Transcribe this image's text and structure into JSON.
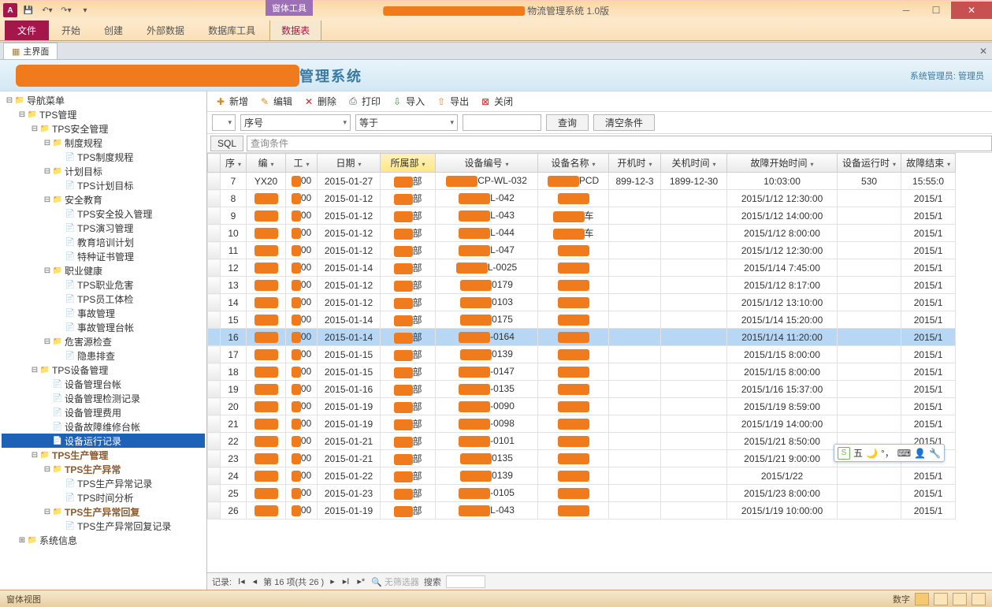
{
  "window": {
    "title_suffix": "物流管理系统 1.0版",
    "contextual": "窗体工具"
  },
  "ribbon": {
    "file": "文件",
    "tabs": [
      "开始",
      "创建",
      "外部数据",
      "数据库工具",
      "数据表"
    ]
  },
  "doc_tab": {
    "label": "主界面"
  },
  "banner": {
    "title_suffix": "管理系统",
    "right": "系统管理员: 管理员"
  },
  "tree": [
    {
      "d": 0,
      "t": "fold",
      "exp": "-",
      "label": "导航菜单"
    },
    {
      "d": 1,
      "t": "fold",
      "exp": "-",
      "label": "TPS管理"
    },
    {
      "d": 2,
      "t": "fold",
      "exp": "-",
      "label": "TPS安全管理"
    },
    {
      "d": 3,
      "t": "fold",
      "exp": "-",
      "label": "制度规程"
    },
    {
      "d": 4,
      "t": "page",
      "label": "TPS制度规程"
    },
    {
      "d": 3,
      "t": "fold",
      "exp": "-",
      "label": "计划目标"
    },
    {
      "d": 4,
      "t": "page",
      "label": "TPS计划目标"
    },
    {
      "d": 3,
      "t": "fold",
      "exp": "-",
      "label": "安全教育"
    },
    {
      "d": 4,
      "t": "page",
      "label": "TPS安全投入管理"
    },
    {
      "d": 4,
      "t": "page",
      "label": "TPS演习管理"
    },
    {
      "d": 4,
      "t": "page",
      "label": "教育培训计划"
    },
    {
      "d": 4,
      "t": "page",
      "label": "特种证书管理"
    },
    {
      "d": 3,
      "t": "fold",
      "exp": "-",
      "label": "职业健康"
    },
    {
      "d": 4,
      "t": "page",
      "label": "TPS职业危害"
    },
    {
      "d": 4,
      "t": "page",
      "label": "TPS员工体检"
    },
    {
      "d": 4,
      "t": "page",
      "label": "事故管理"
    },
    {
      "d": 4,
      "t": "page",
      "label": "事故管理台帐"
    },
    {
      "d": 3,
      "t": "fold",
      "exp": "-",
      "label": "危害源检查"
    },
    {
      "d": 4,
      "t": "page",
      "label": "隐患排查"
    },
    {
      "d": 2,
      "t": "fold",
      "exp": "-",
      "label": "TPS设备管理"
    },
    {
      "d": 3,
      "t": "page",
      "label": "设备管理台帐"
    },
    {
      "d": 3,
      "t": "page",
      "label": "设备管理检测记录"
    },
    {
      "d": 3,
      "t": "page",
      "label": "设备管理费用"
    },
    {
      "d": 3,
      "t": "page",
      "label": "设备故障维修台帐"
    },
    {
      "d": 3,
      "t": "page",
      "label": "设备运行记录",
      "sel": true
    },
    {
      "d": 2,
      "t": "fold",
      "exp": "-",
      "label": "TPS生产管理",
      "brown": true
    },
    {
      "d": 3,
      "t": "fold",
      "exp": "-",
      "label": "TPS生产异常",
      "brown": true
    },
    {
      "d": 4,
      "t": "page",
      "label": "TPS生产异常记录"
    },
    {
      "d": 4,
      "t": "page",
      "label": "TPS时间分析"
    },
    {
      "d": 3,
      "t": "fold",
      "exp": "-",
      "label": "TPS生产异常回复",
      "brown": true
    },
    {
      "d": 4,
      "t": "page",
      "label": "TPS生产异常回复记录"
    },
    {
      "d": 1,
      "t": "fold",
      "exp": "+",
      "label": "系统信息"
    }
  ],
  "toolbar": {
    "new": "新增",
    "edit": "编辑",
    "del": "删除",
    "print": "打印",
    "import": "导入",
    "export": "导出",
    "close": "关闭"
  },
  "filter": {
    "field": "序号",
    "op": "等于",
    "query": "查询",
    "clear": "清空条件",
    "sql": "SQL",
    "sql_ph": "查询条件"
  },
  "grid": {
    "cols": [
      "",
      "序",
      "编",
      "工",
      "日期",
      "所属部",
      "设备编号",
      "设备名称",
      "开机时",
      "关机时间",
      "故障开始时间",
      "设备运行时",
      "故障结束"
    ],
    "rows": [
      {
        "n": 7,
        "a": "YX20",
        "b": "00",
        "d": "2015-01-27",
        "dev": "CP-WL-032",
        "name": "PCD",
        "on": "899-12-3",
        "off": "1899-12-30",
        "fs": "10:03:00",
        "rt": "530",
        "fe": "15:55:0"
      },
      {
        "n": 8,
        "b": "00",
        "d": "2015-01-12",
        "dev": "L-042",
        "fs": "2015/1/12 12:30:00",
        "fe": "2015/1"
      },
      {
        "n": 9,
        "b": "00",
        "d": "2015-01-12",
        "dev": "L-043",
        "name": "车",
        "fs": "2015/1/12 14:00:00",
        "fe": "2015/1"
      },
      {
        "n": 10,
        "b": "00",
        "d": "2015-01-12",
        "dev": "L-044",
        "name": "车",
        "fs": "2015/1/12 8:00:00",
        "fe": "2015/1"
      },
      {
        "n": 11,
        "b": "00",
        "d": "2015-01-12",
        "dev": "L-047",
        "fs": "2015/1/12 12:30:00",
        "fe": "2015/1"
      },
      {
        "n": 12,
        "b": "00",
        "d": "2015-01-14",
        "dev": "L-0025",
        "fs": "2015/1/14 7:45:00",
        "fe": "2015/1"
      },
      {
        "n": 13,
        "b": "00",
        "d": "2015-01-12",
        "dev": "0179",
        "fs": "2015/1/12 8:17:00",
        "fe": "2015/1"
      },
      {
        "n": 14,
        "b": "00",
        "d": "2015-01-12",
        "dev": "0103",
        "fs": "2015/1/12 13:10:00",
        "fe": "2015/1"
      },
      {
        "n": 15,
        "b": "00",
        "d": "2015-01-14",
        "dev": "0175",
        "fs": "2015/1/14 15:20:00",
        "fe": "2015/1"
      },
      {
        "n": 16,
        "b": "00",
        "d": "2015-01-14",
        "dev": "-0164",
        "fs": "2015/1/14 11:20:00",
        "fe": "2015/1",
        "sel": true
      },
      {
        "n": 17,
        "b": "00",
        "d": "2015-01-15",
        "dev": "0139",
        "fs": "2015/1/15 8:00:00",
        "fe": "2015/1"
      },
      {
        "n": 18,
        "b": "00",
        "d": "2015-01-15",
        "dev": "-0147",
        "fs": "2015/1/15 8:00:00",
        "fe": "2015/1"
      },
      {
        "n": 19,
        "b": "00",
        "d": "2015-01-16",
        "dev": "-0135",
        "fs": "2015/1/16 15:37:00",
        "fe": "2015/1"
      },
      {
        "n": 20,
        "b": "00",
        "d": "2015-01-19",
        "dev": "-0090",
        "fs": "2015/1/19 8:59:00",
        "fe": "2015/1"
      },
      {
        "n": 21,
        "b": "00",
        "d": "2015-01-19",
        "dev": "-0098",
        "fs": "2015/1/19 14:00:00",
        "fe": "2015/1"
      },
      {
        "n": 22,
        "b": "00",
        "d": "2015-01-21",
        "dev": "-0101",
        "fs": "2015/1/21 8:50:00",
        "fe": "2015/1"
      },
      {
        "n": 23,
        "b": "00",
        "d": "2015-01-21",
        "dev": "0135",
        "fs": "2015/1/21 9:00:00",
        "fe": "2015/1"
      },
      {
        "n": 24,
        "b": "00",
        "d": "2015-01-22",
        "dev": "0139",
        "fs": "2015/1/22",
        "fe": "2015/1"
      },
      {
        "n": 25,
        "b": "00",
        "d": "2015-01-23",
        "dev": "-0105",
        "fs": "2015/1/23 8:00:00",
        "fe": "2015/1"
      },
      {
        "n": 26,
        "b": "00",
        "d": "2015-01-19",
        "dev": "L-043",
        "fs": "2015/1/19 10:00:00",
        "fe": "2015/1"
      }
    ]
  },
  "recnav": {
    "label": "记录:",
    "pos": "第 16 项(共 26 )",
    "nofilter": "无筛选器",
    "search": "搜索"
  },
  "ime": {
    "text": "五"
  },
  "status": {
    "left": "窗体视图",
    "right": "数字"
  }
}
